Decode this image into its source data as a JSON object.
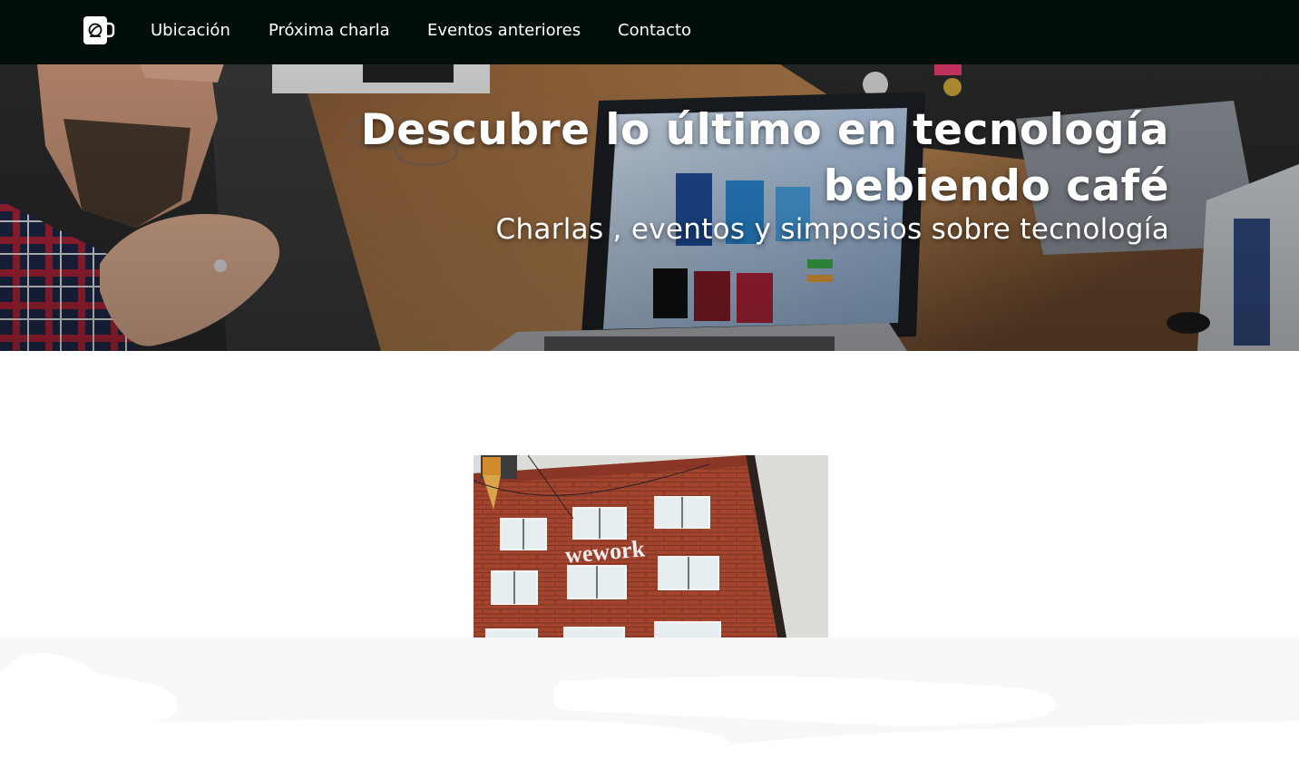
{
  "nav": {
    "logo_icon": "coffee-cup-icon",
    "links": [
      {
        "label": "Ubicación"
      },
      {
        "label": "Próxima charla"
      },
      {
        "label": "Eventos anteriores"
      },
      {
        "label": "Contacto"
      }
    ]
  },
  "hero": {
    "title_line1": "Descubre lo último en tecnología",
    "title_line2": "bebiendo café",
    "subtitle": "Charlas , eventos y simposios sobre tecnología"
  },
  "venue_card": {
    "sign_text": "wework"
  },
  "colors": {
    "navbar_bg": "#010e0a",
    "text_on_dark": "#ffffff",
    "footer_band_bg": "#f8f8f8"
  }
}
